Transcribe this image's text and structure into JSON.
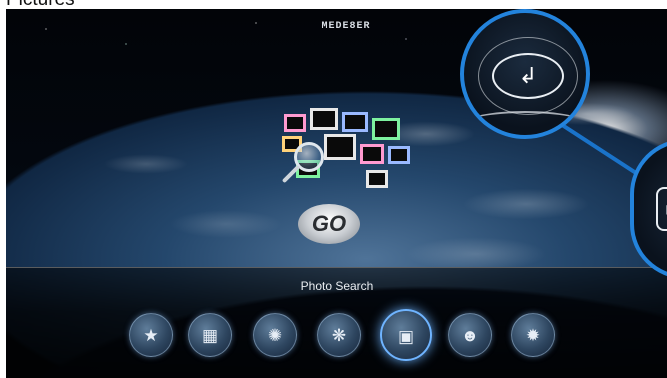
{
  "page": {
    "title": "Pictures"
  },
  "header": {
    "brand": "MEDE8ER"
  },
  "hero": {
    "search_logo_text": "GO"
  },
  "menu": {
    "selected_label": "Photo Search",
    "items": [
      {
        "icon": "favorites-icon",
        "glyph": "★"
      },
      {
        "icon": "folder-tag-icon",
        "glyph": "▦"
      },
      {
        "icon": "filmstrip-icon",
        "glyph": "✺"
      },
      {
        "icon": "photo-effects-icon",
        "glyph": "❋"
      },
      {
        "icon": "photo-search-icon",
        "glyph": "▣",
        "selected": true
      },
      {
        "icon": "people-icon",
        "glyph": "☻"
      },
      {
        "icon": "settings-gear-icon",
        "glyph": "✹"
      }
    ]
  },
  "zoom": {
    "enter_button": {
      "icon": "enter-return-icon",
      "glyph": "↲"
    },
    "grid_button": {
      "icon": "grid-view-icon",
      "glyph": "▦"
    }
  },
  "colors": {
    "accent": "#2383dc",
    "selected_glow": "#6fb4ff"
  }
}
